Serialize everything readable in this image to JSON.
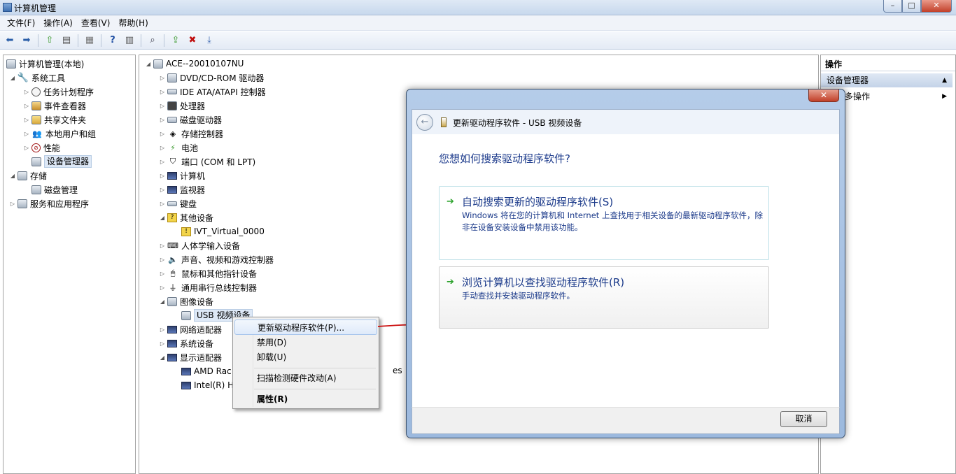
{
  "window": {
    "title": "计算机管理",
    "min": "–",
    "max": "□",
    "close": "✕"
  },
  "menu": [
    "文件(F)",
    "操作(A)",
    "查看(V)",
    "帮助(H)"
  ],
  "left_tree": [
    {
      "label": "计算机管理(本地)",
      "level": 0,
      "toggle": "",
      "icon": "computer-management-icon"
    },
    {
      "label": "系统工具",
      "level": 1,
      "toggle": "◢",
      "icon": "system-tools-icon"
    },
    {
      "label": "任务计划程序",
      "level": 2,
      "toggle": "▷",
      "icon": "task-scheduler-icon"
    },
    {
      "label": "事件查看器",
      "level": 2,
      "toggle": "▷",
      "icon": "event-viewer-icon"
    },
    {
      "label": "共享文件夹",
      "level": 2,
      "toggle": "▷",
      "icon": "shared-folders-icon"
    },
    {
      "label": "本地用户和组",
      "level": 2,
      "toggle": "▷",
      "icon": "local-users-icon"
    },
    {
      "label": "性能",
      "level": 2,
      "toggle": "▷",
      "icon": "performance-icon"
    },
    {
      "label": "设备管理器",
      "level": 2,
      "toggle": "",
      "icon": "device-manager-icon",
      "selected": true
    },
    {
      "label": "存储",
      "level": 1,
      "toggle": "◢",
      "icon": "storage-icon"
    },
    {
      "label": "磁盘管理",
      "level": 2,
      "toggle": "",
      "icon": "disk-management-icon"
    },
    {
      "label": "服务和应用程序",
      "level": 1,
      "toggle": "▷",
      "icon": "services-apps-icon"
    }
  ],
  "device_tree": [
    {
      "label": "ACE--20010107NU",
      "level": 0,
      "toggle": "◢",
      "icon": "computer-icon"
    },
    {
      "label": "DVD/CD-ROM 驱动器",
      "level": 1,
      "toggle": "▷",
      "icon": "dvd-drive-icon"
    },
    {
      "label": "IDE ATA/ATAPI 控制器",
      "level": 1,
      "toggle": "▷",
      "icon": "ide-controller-icon"
    },
    {
      "label": "处理器",
      "level": 1,
      "toggle": "▷",
      "icon": "processor-icon"
    },
    {
      "label": "磁盘驱动器",
      "level": 1,
      "toggle": "▷",
      "icon": "disk-drive-icon"
    },
    {
      "label": "存储控制器",
      "level": 1,
      "toggle": "▷",
      "icon": "storage-controller-icon"
    },
    {
      "label": "电池",
      "level": 1,
      "toggle": "▷",
      "icon": "battery-icon"
    },
    {
      "label": "端口 (COM 和 LPT)",
      "level": 1,
      "toggle": "▷",
      "icon": "port-icon"
    },
    {
      "label": "计算机",
      "level": 1,
      "toggle": "▷",
      "icon": "computer-icon"
    },
    {
      "label": "监视器",
      "level": 1,
      "toggle": "▷",
      "icon": "monitor-icon"
    },
    {
      "label": "键盘",
      "level": 1,
      "toggle": "▷",
      "icon": "keyboard-icon"
    },
    {
      "label": "其他设备",
      "level": 1,
      "toggle": "◢",
      "icon": "other-devices-icon"
    },
    {
      "label": "IVT_Virtual_0000",
      "level": 2,
      "toggle": "",
      "icon": "warning-device-icon"
    },
    {
      "label": "人体学输入设备",
      "level": 1,
      "toggle": "▷",
      "icon": "hid-icon"
    },
    {
      "label": "声音、视频和游戏控制器",
      "level": 1,
      "toggle": "▷",
      "icon": "sound-icon"
    },
    {
      "label": "鼠标和其他指针设备",
      "level": 1,
      "toggle": "▷",
      "icon": "mouse-icon"
    },
    {
      "label": "通用串行总线控制器",
      "level": 1,
      "toggle": "▷",
      "icon": "usb-controller-icon"
    },
    {
      "label": "图像设备",
      "level": 1,
      "toggle": "◢",
      "icon": "imaging-device-icon"
    },
    {
      "label": "USB 视频设备",
      "level": 2,
      "toggle": "",
      "icon": "camera-icon",
      "selected": true
    },
    {
      "label": "网络适配器",
      "level": 1,
      "toggle": "▷",
      "icon": "network-adapter-icon"
    },
    {
      "label": "系统设备",
      "level": 1,
      "toggle": "▷",
      "icon": "system-device-icon"
    },
    {
      "label": "显示适配器",
      "level": 1,
      "toggle": "◢",
      "icon": "display-adapter-icon"
    },
    {
      "label": "AMD Rac",
      "level": 2,
      "toggle": "",
      "icon": "display-warning-icon"
    },
    {
      "label": "Intel(R) H",
      "level": 2,
      "toggle": "",
      "icon": "display-device-icon"
    }
  ],
  "fragment": "es",
  "context_menu": {
    "items": [
      {
        "label": "更新驱动程序软件(P)...",
        "highlighted": true
      },
      {
        "label": "禁用(D)"
      },
      {
        "label": "卸载(U)"
      },
      {
        "label": "扫描检测硬件改动(A)"
      },
      {
        "label": "属性(R)",
        "bold": true
      }
    ]
  },
  "actions_pane": {
    "header": "操作",
    "section": "设备管理器",
    "item": "更多操作"
  },
  "dialog": {
    "title": "更新驱动程序软件 - USB 视频设备",
    "question": "您想如何搜索驱动程序软件?",
    "options": [
      {
        "title": "自动搜索更新的驱动程序软件(S)",
        "desc": "Windows 将在您的计算机和 Internet 上查找用于相关设备的最新驱动程序软件，除非在设备安装设备中禁用该功能。"
      },
      {
        "title": "浏览计算机以查找驱动程序软件(R)",
        "desc": "手动查找并安装驱动程序软件。"
      }
    ],
    "cancel": "取消",
    "close": "✕"
  },
  "colors": {
    "link_blue": "#1b3a8a",
    "green_arrow": "#2aa12a",
    "annotation_red": "#cc1010"
  }
}
